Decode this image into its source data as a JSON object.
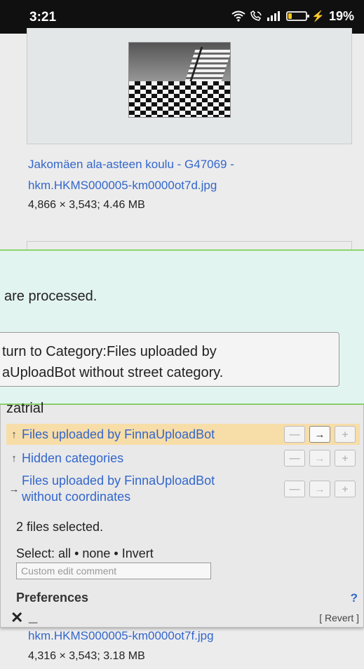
{
  "status_bar": {
    "time": "3:21",
    "wifi_icon": "wifi-icon",
    "call_icon": "wifi-calling-icon",
    "signal_icon": "signal-bars-icon",
    "battery_percent": "19%",
    "battery_level": 0.19,
    "battery_color": "#f5c518",
    "charging_color": "#e94b4b"
  },
  "gallery": {
    "item1": {
      "link_line1": "Jakomäen ala-asteen koulu - G47069 -",
      "link_line2": "hkm.HKMS000005-km0000ot7d.jpg",
      "size": "4,866 × 3,543; 4.46 MB"
    },
    "item2": {
      "link": "hkm.HKMS000005-km0000ot7f.jpg",
      "size": "4,316 × 3,543; 3.18 MB"
    },
    "link_color": "#3366cc"
  },
  "notice": {
    "message": "are processed.",
    "button_line1": "turn to Category:Files uploaded by",
    "button_line2": "aUploadBot without street category.",
    "accent": "#8bd36e",
    "background": "#e2f4ef"
  },
  "editor": {
    "cut_text": "zatrial",
    "categories": [
      {
        "arrow": "↑",
        "name": "Files uploaded by FinnaUploadBot",
        "highlight": true
      },
      {
        "arrow": "↑",
        "name": "Hidden categories",
        "highlight": false
      },
      {
        "arrow": "→",
        "name_line1": "Files uploaded by FinnaUploadBot",
        "name_line2": "without coordinates",
        "highlight": false
      }
    ],
    "btn_minus": "—",
    "btn_arrow": "→",
    "btn_plus": "+",
    "selected_count": "2 files selected.",
    "select_label": "Select:",
    "select_all": "all",
    "select_none": "none",
    "select_invert": "Invert",
    "comment_placeholder": "Custom edit comment",
    "preferences": "Preferences",
    "help": "?",
    "close": "✕",
    "minimize": "_",
    "revert": "[ Revert ]",
    "highlight_color": "#f7dda8"
  }
}
